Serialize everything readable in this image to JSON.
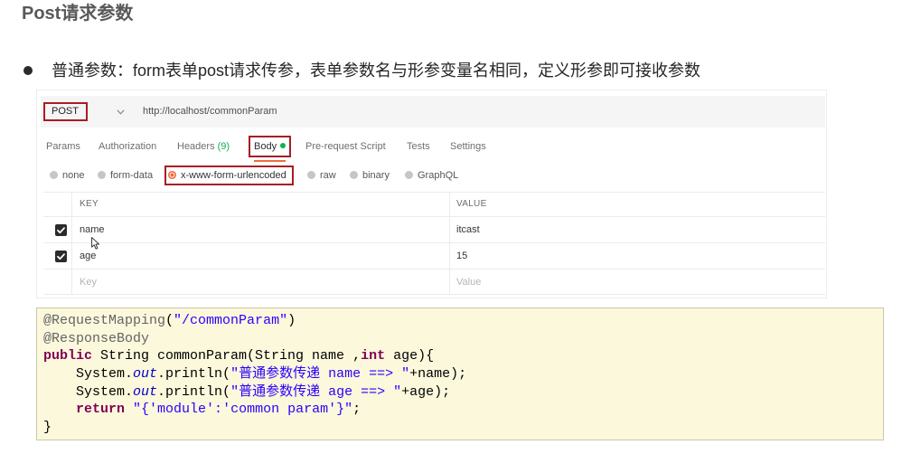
{
  "title": "Post请求参数",
  "bullet_text": "普通参数：form表单post请求传参，表单参数名与形参变量名相同，定义形参即可接收参数",
  "icons": {
    "bullet": "bullet-dot-icon",
    "method_dropdown": "chevron-down-icon",
    "row_checkbox": "checkbox-checked-icon",
    "pointer": "mouse-pointer-icon",
    "body_indicator": "green-dot-icon"
  },
  "colors": {
    "highlight_box": "#a61e24",
    "accent_orange": "#f26b3a",
    "indicator_green": "#0cb34f",
    "code_background": "#fbf8dc",
    "code_annotation": "#646464",
    "code_keyword": "#7f0055",
    "code_string": "#2a00ff",
    "code_static_field": "#0000c0"
  },
  "postman": {
    "method": "POST",
    "url": "http://localhost/commonParam",
    "tabs": [
      {
        "label": "Params"
      },
      {
        "label": "Authorization"
      },
      {
        "label": "Headers",
        "badge": "(9)"
      },
      {
        "label": "Body",
        "active": true
      },
      {
        "label": "Pre-request Script"
      },
      {
        "label": "Tests"
      },
      {
        "label": "Settings"
      }
    ],
    "body_types": [
      {
        "label": "none"
      },
      {
        "label": "form-data"
      },
      {
        "label": "x-www-form-urlencoded",
        "selected": true
      },
      {
        "label": "raw"
      },
      {
        "label": "binary"
      },
      {
        "label": "GraphQL"
      }
    ],
    "params_table": {
      "columns": [
        "KEY",
        "VALUE"
      ],
      "rows": [
        {
          "checked": true,
          "key": "name",
          "value": "itcast"
        },
        {
          "checked": true,
          "key": "age",
          "value": "15"
        }
      ],
      "new_row_placeholder": {
        "key": "Key",
        "value": "Value"
      }
    }
  },
  "code": {
    "lines": [
      [
        {
          "annotation": "@RequestMapping"
        },
        {
          "plain": "("
        },
        {
          "string": "\"/commonParam\""
        },
        {
          "plain": ")"
        }
      ],
      [
        {
          "annotation": "@ResponseBody"
        }
      ],
      [
        {
          "keyword": "public"
        },
        {
          "plain": " String commonParam(String name ,"
        },
        {
          "keyword": "int"
        },
        {
          "plain": " age){"
        }
      ],
      [
        {
          "plain": "    System."
        },
        {
          "field": "out"
        },
        {
          "plain": ".println("
        },
        {
          "string": "\"普通参数传递 name ==> \""
        },
        {
          "plain": "+name);"
        }
      ],
      [
        {
          "plain": "    System."
        },
        {
          "field": "out"
        },
        {
          "plain": ".println("
        },
        {
          "string": "\"普通参数传递 age ==> \""
        },
        {
          "plain": "+age);"
        }
      ],
      [
        {
          "plain": "    "
        },
        {
          "keyword": "return"
        },
        {
          "plain": " "
        },
        {
          "string": "\"{'module':'common param'}\""
        },
        {
          "plain": ";"
        }
      ],
      [
        {
          "plain": "}"
        }
      ]
    ]
  }
}
